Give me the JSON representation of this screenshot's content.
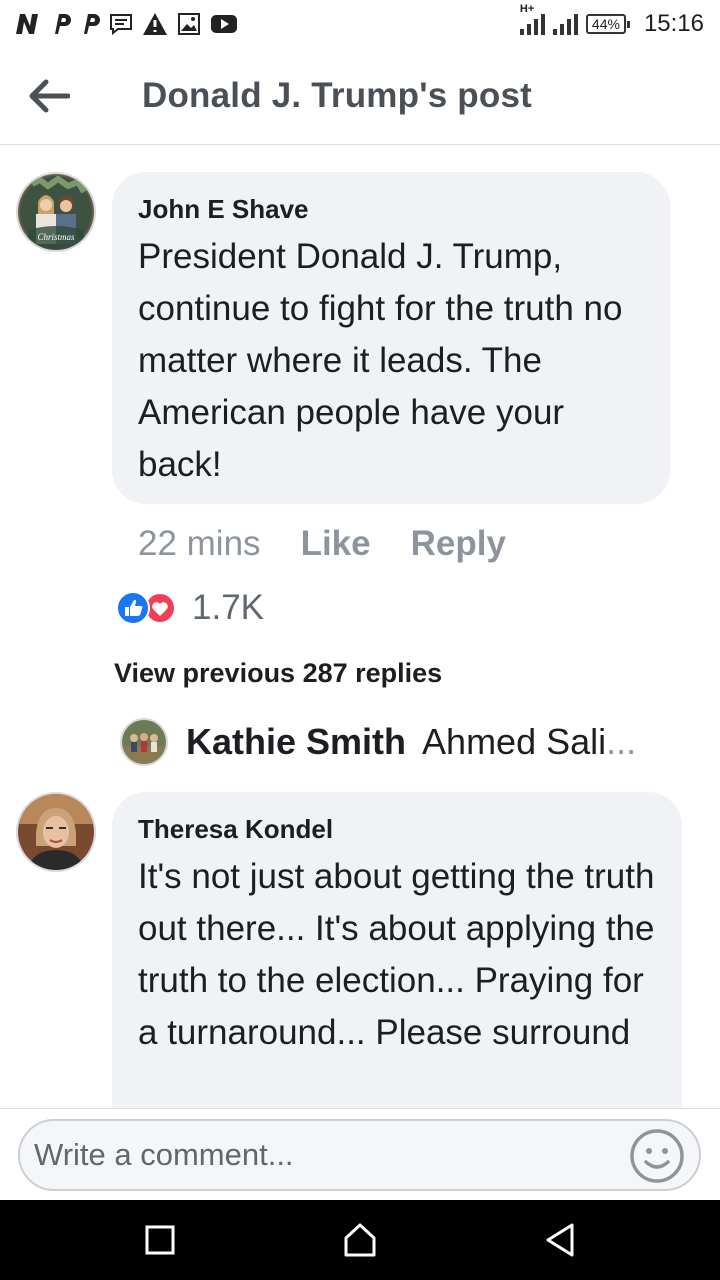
{
  "status_bar": {
    "time": "15:16",
    "battery": "44%",
    "network": "H+",
    "notification_icons": [
      "n-icon",
      "p-icon",
      "p-icon",
      "message-icon",
      "warning-icon",
      "image-icon",
      "youtube-icon"
    ]
  },
  "header": {
    "title": "Donald J. Trump's post",
    "back_icon": "arrow-left-icon"
  },
  "comments": [
    {
      "author": "John E Shave",
      "text": "President Donald J. Trump, continue to fight for the truth no matter where it leads. The American people have your back!",
      "time": "22 mins",
      "like_label": "Like",
      "reply_label": "Reply",
      "reaction_count": "1.7K",
      "reaction_icons": [
        "like-icon",
        "love-icon"
      ],
      "avatar_caption": "Christmas"
    }
  ],
  "thread": {
    "view_previous": "View previous 287 replies",
    "reply_name": "Kathie Smith",
    "reply_snippet": "Ahmed Sali",
    "reply_ellipsis": "..."
  },
  "comment2": {
    "author": "Theresa Kondel",
    "text": "It's not just about getting the truth out there... It's about applying the truth to the election... Praying for a turnaround... Please surround"
  },
  "composer": {
    "placeholder": "Write a comment...",
    "emoji_icon": "emoji-icon"
  },
  "navbar": {
    "buttons": [
      "recents-icon",
      "home-icon",
      "back-triangle-icon"
    ]
  },
  "colors": {
    "bubble": "#f0f2f5",
    "like_blue": "#1877f2",
    "love_red": "#f33e58",
    "muted": "#8d949e"
  }
}
